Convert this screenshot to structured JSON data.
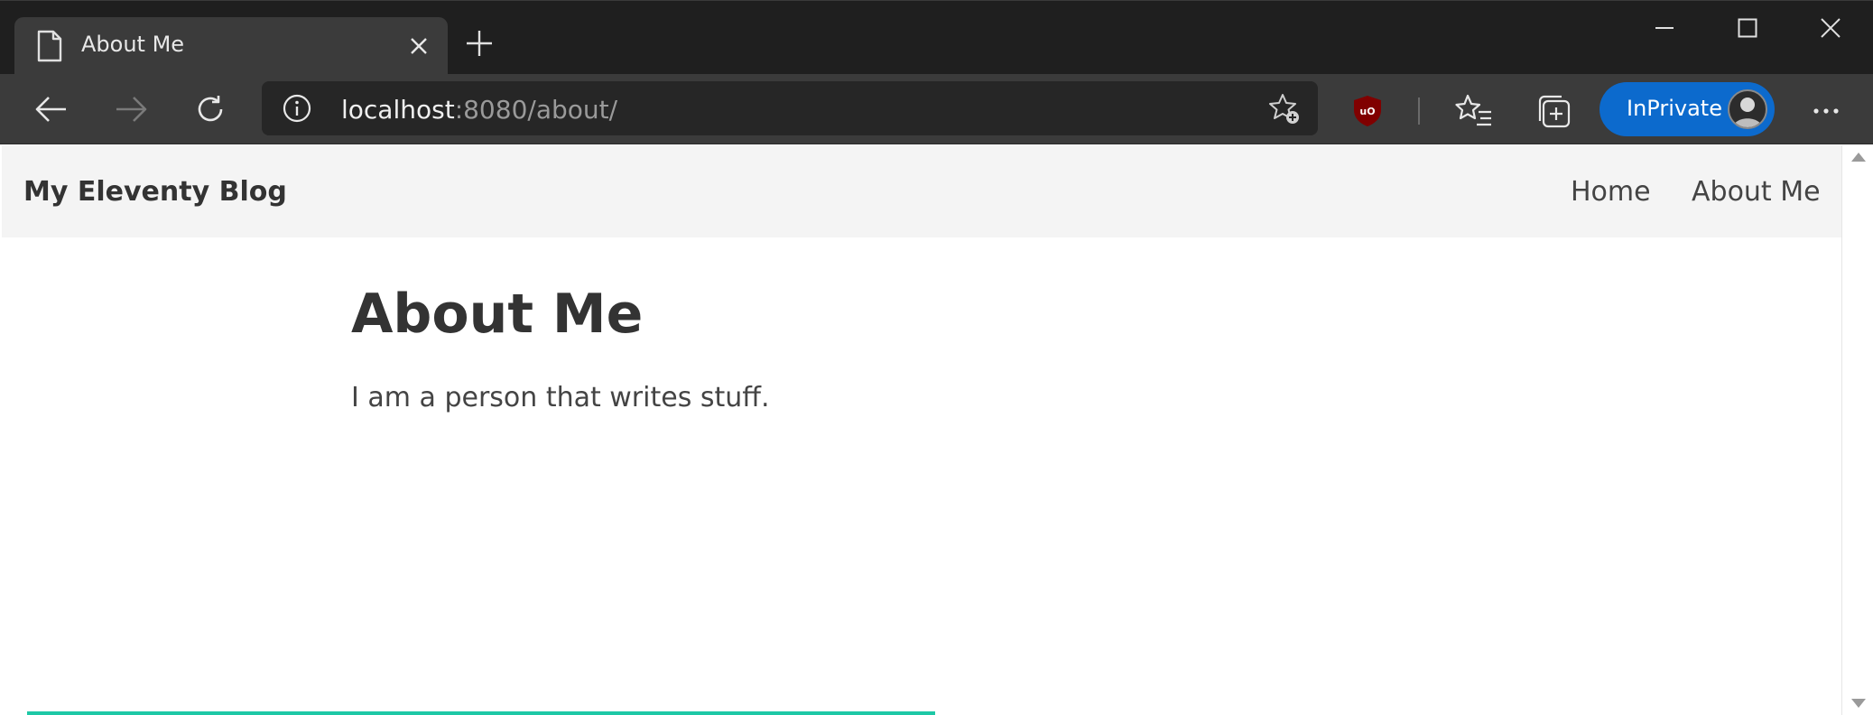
{
  "browser": {
    "tab": {
      "title": "About Me",
      "icon": "page-icon"
    },
    "address": {
      "host": "localhost",
      "rest": ":8080/about/"
    },
    "profile": {
      "label": "InPrivate"
    },
    "colors": {
      "frame": "#1f1f1f",
      "toolbar": "#3b3b3b",
      "accent": "#0c6acd",
      "load_bar": "#1ec8a6"
    }
  },
  "site": {
    "brand": "My Eleventy Blog",
    "nav": [
      {
        "label": "Home"
      },
      {
        "label": "About Me"
      }
    ],
    "heading": "About Me",
    "body": "I am a person that writes stuff."
  }
}
